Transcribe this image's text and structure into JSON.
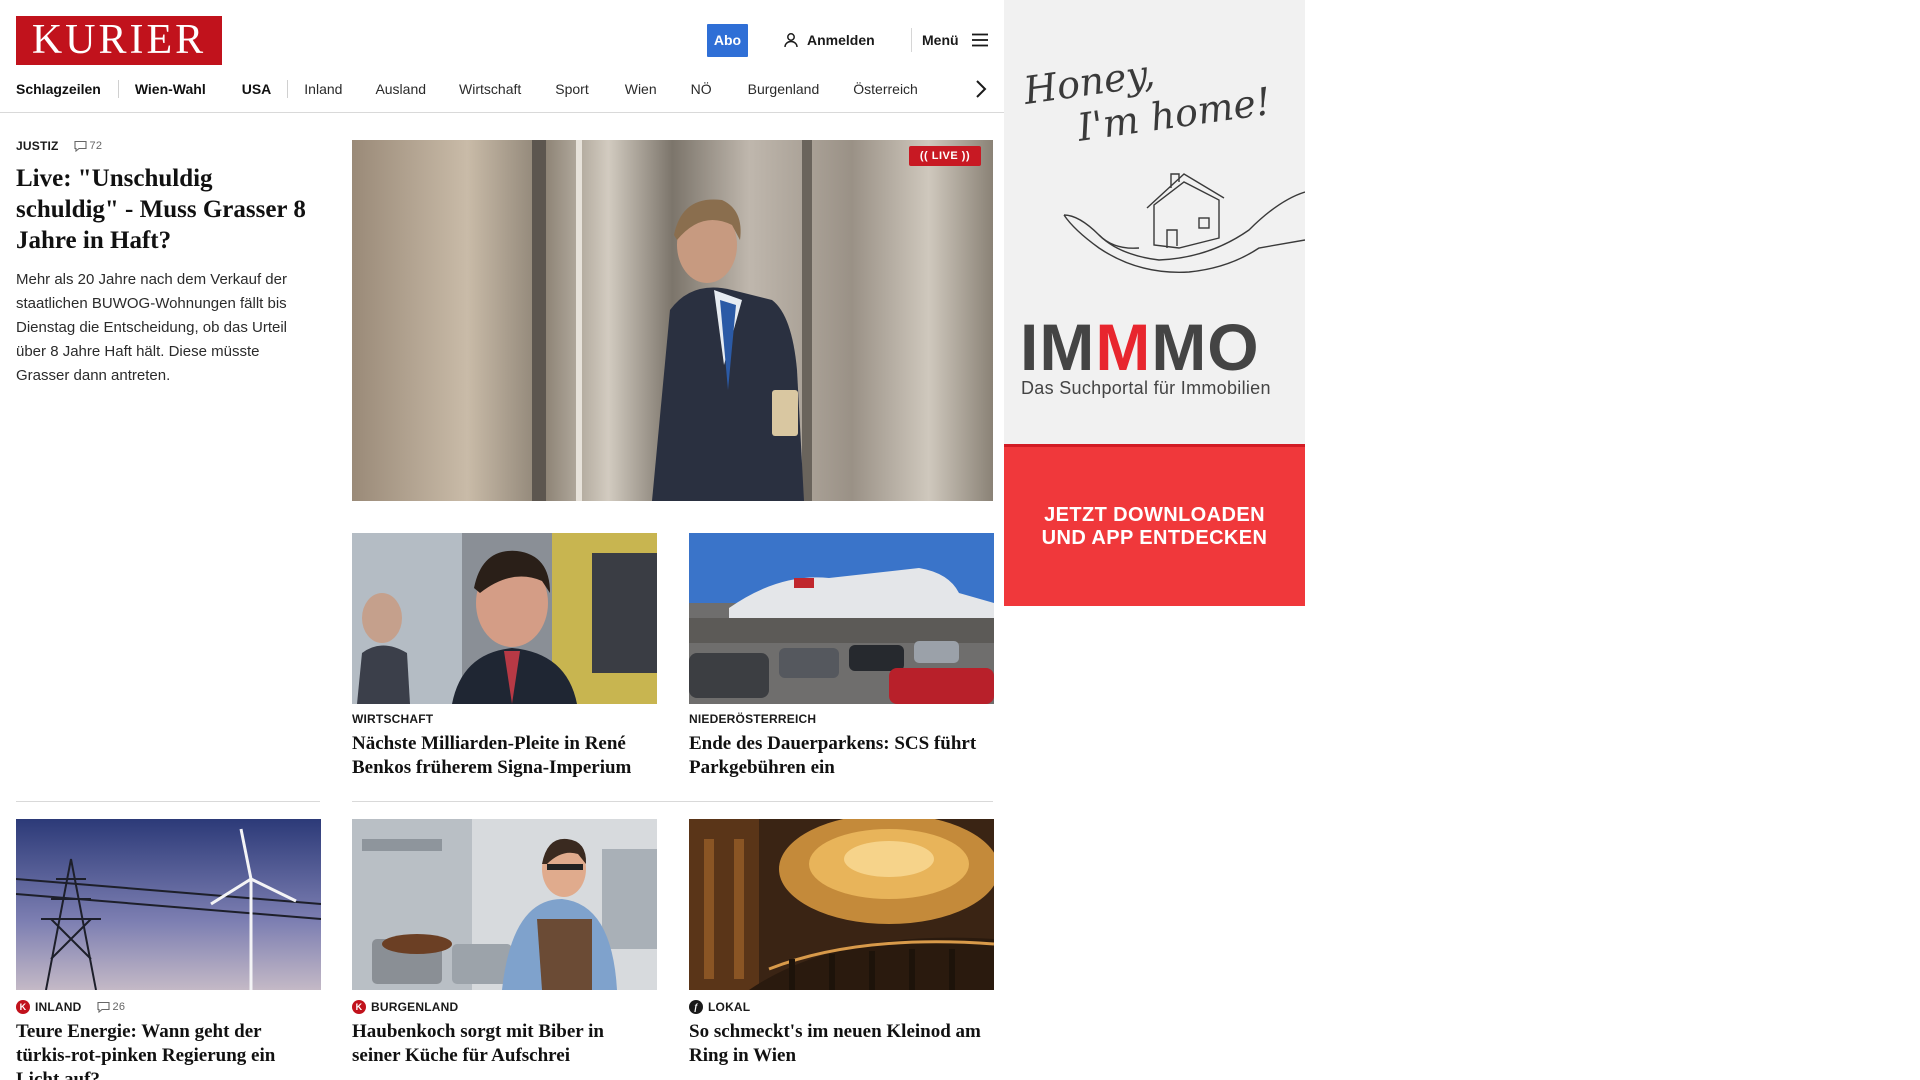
{
  "header": {
    "logo": "KURIER",
    "abo_label": "Abo",
    "login_label": "Anmelden",
    "menu_label": "Menü"
  },
  "nav": {
    "items": [
      "Schlagzeilen",
      "Wien-Wahl",
      "USA",
      "Inland",
      "Ausland",
      "Wirtschaft",
      "Sport",
      "Wien",
      "NÖ",
      "Burgenland",
      "Österreich"
    ]
  },
  "lead": {
    "category": "JUSTIZ",
    "comments": "72",
    "headline": "Live: \"Unschuldig schuldig\" - Muss Grasser 8 Jahre in Haft?",
    "teaser": "Mehr als 20 Jahre nach dem Verkauf der staatlichen BUWOG-Wohnungen fällt bis Dienstag die Entscheidung, ob das Urteil über 8 Jahre Haft hält. Diese müsste Grasser dann antreten.",
    "live_badge": "(( LIVE ))"
  },
  "articles": [
    {
      "category": "WIRTSCHAFT",
      "headline": "Nächste Milliarden-Pleite in René Benkos früherem Signa-Imperium"
    },
    {
      "category": "NIEDERÖSTERREICH",
      "headline": "Ende des Dauerparkens: SCS führt Parkgebühren ein"
    },
    {
      "category": "INLAND",
      "comments": "26",
      "headline": "Teure Energie: Wann geht der türkis-rot-pinken Regierung ein Licht auf?",
      "badge": "K"
    },
    {
      "category": "BURGENLAND",
      "headline": "Haubenkoch sorgt mit Biber in seiner Küche für Aufschrei",
      "badge": "K"
    },
    {
      "category": "LOKAL",
      "headline": "So schmeckt's im neuen Kleinod am Ring in Wien",
      "badge": "f"
    }
  ],
  "ad": {
    "tagline_1": "Honey,",
    "tagline_2": "I'm home!",
    "brand_1": "IM",
    "brand_2": "M",
    "brand_3": "MO",
    "subline": "Das Suchportal für Immobilien",
    "cta_1": "JETZT DOWNLOADEN",
    "cta_2": "UND APP ENTDECKEN"
  },
  "colors": {
    "brand_red": "#c1121c",
    "abo_blue": "#2f6fd6",
    "ad_red": "#f0383b",
    "live_red": "#c81923"
  }
}
